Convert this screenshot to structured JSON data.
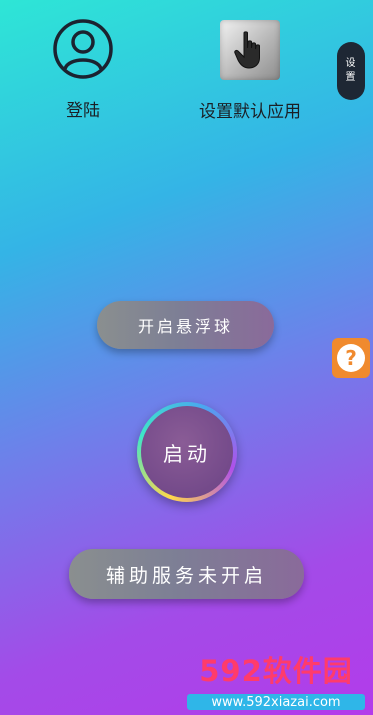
{
  "top_actions": {
    "login_label": "登陆",
    "default_app_label": "设置默认应用"
  },
  "settings_tab": {
    "line1": "设",
    "line2": "置"
  },
  "help": {
    "symbol": "?"
  },
  "buttons": {
    "floating_ball": "开启悬浮球",
    "start": "启动",
    "accessibility_status": "辅助服务未开启"
  },
  "watermark": {
    "title": "592软件园",
    "url": "www.592xiazai.com"
  },
  "icons": {
    "login": "user-avatar-icon",
    "default_app": "hand-pointer-icon",
    "help": "question-mark-icon"
  },
  "colors": {
    "gradient_top": "#2ee6d6",
    "gradient_bottom": "#b33bea",
    "help_orange": "#f08a2e",
    "settings_dark": "#1e2734",
    "watermark_pink": "#ff3b6b",
    "watermark_blue": "#2fb6e8"
  }
}
